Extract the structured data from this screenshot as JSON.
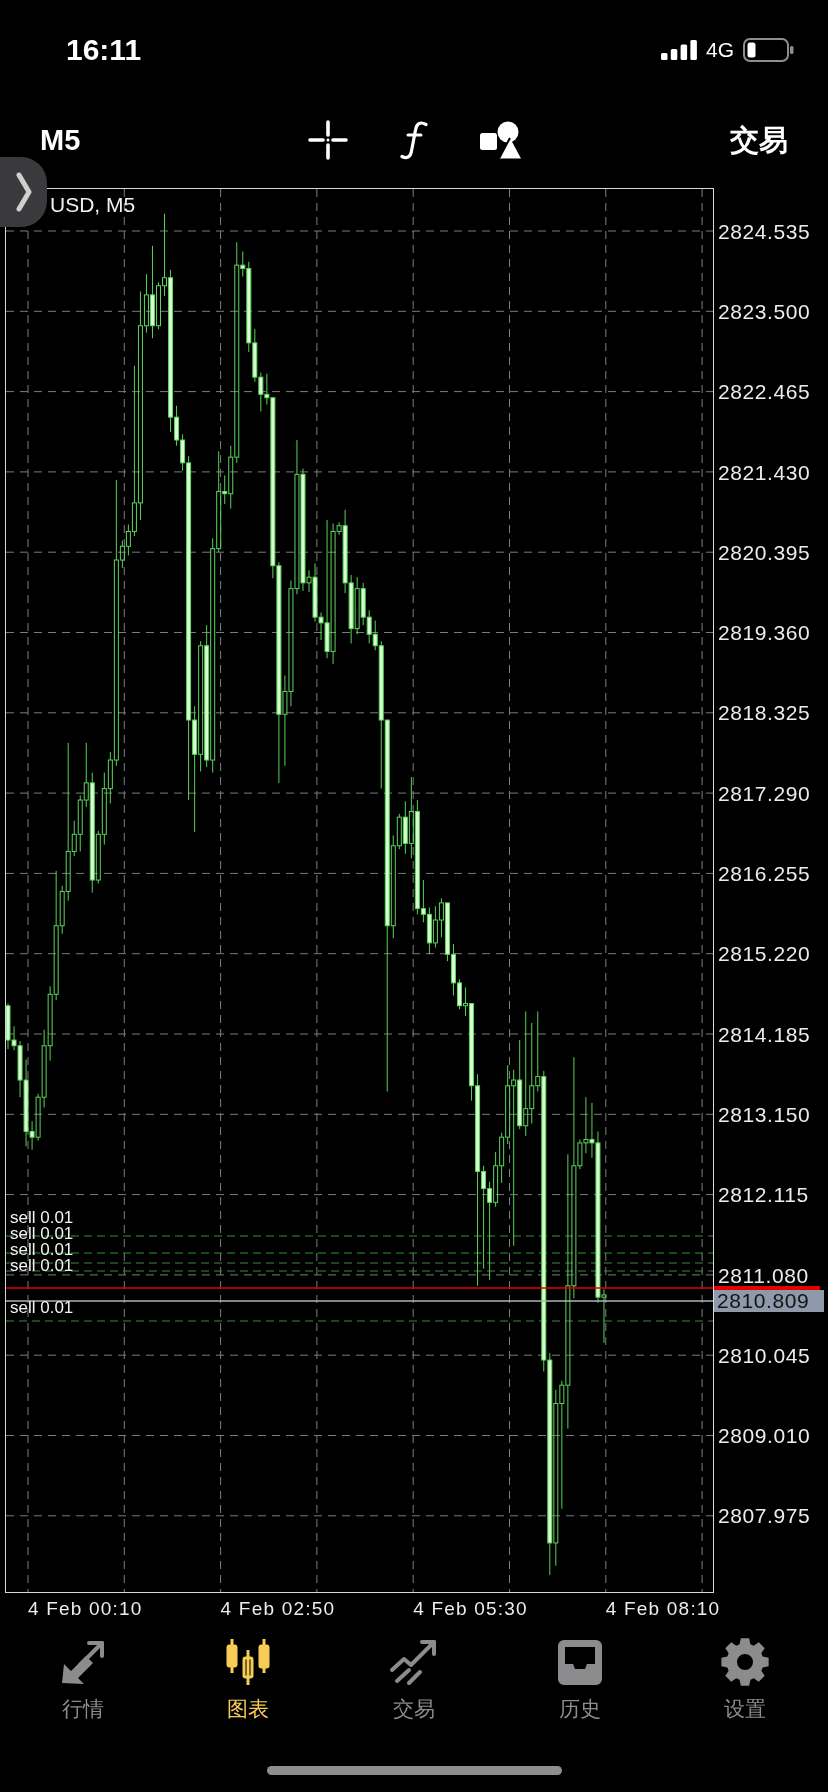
{
  "status_bar": {
    "time": "16:11",
    "network": "4G"
  },
  "toolbar": {
    "timeframe": "M5",
    "trade": "交易"
  },
  "chart": {
    "title": "USD, M5",
    "price_labels": [
      "2824.535",
      "2823.500",
      "2822.465",
      "2821.430",
      "2820.395",
      "2819.360",
      "2818.325",
      "2817.290",
      "2816.255",
      "2815.220",
      "2814.185",
      "2813.150",
      "2812.115",
      "2811.080",
      "2810.045",
      "2809.010",
      "2807.975"
    ],
    "time_labels": [
      "4 Feb 00:10",
      "4 Feb 02:50",
      "4 Feb 05:30",
      "4 Feb 08:10"
    ],
    "orders": [
      {
        "label": "sell 0.01"
      },
      {
        "label": "sell 0.01"
      },
      {
        "label": "sell 0.01"
      },
      {
        "label": "sell 0.01"
      },
      {
        "label": "sell 0.01"
      }
    ],
    "ask_price": "2810.809"
  },
  "tab_bar": {
    "tabs": [
      {
        "label": "行情",
        "selected": false
      },
      {
        "label": "图表",
        "selected": true
      },
      {
        "label": "交易",
        "selected": false
      },
      {
        "label": "历史",
        "selected": false
      },
      {
        "label": "设置",
        "selected": false
      }
    ]
  }
}
